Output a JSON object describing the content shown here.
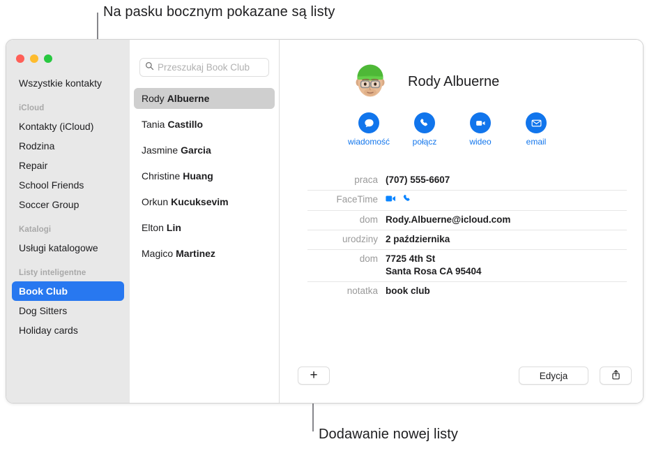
{
  "callouts": {
    "top": "Na pasku bocznym pokazane są listy",
    "bottom": "Dodawanie nowej listy"
  },
  "window": {
    "traffic_lights": {
      "close": "close-button",
      "minimize": "minimize-button",
      "zoom": "zoom-button"
    }
  },
  "sidebar": {
    "all_contacts": "Wszystkie kontakty",
    "sections": [
      {
        "header": "iCloud",
        "items": [
          {
            "label": "Kontakty (iCloud)",
            "selected": false
          },
          {
            "label": "Rodzina",
            "selected": false
          },
          {
            "label": "Repair",
            "selected": false
          },
          {
            "label": "School Friends",
            "selected": false
          },
          {
            "label": "Soccer Group",
            "selected": false
          }
        ]
      },
      {
        "header": "Katalogi",
        "items": [
          {
            "label": "Usługi katalogowe",
            "selected": false
          }
        ]
      },
      {
        "header": "Listy inteligentne",
        "items": [
          {
            "label": "Book Club",
            "selected": true
          },
          {
            "label": "Dog Sitters",
            "selected": false
          },
          {
            "label": "Holiday cards",
            "selected": false
          }
        ]
      }
    ],
    "selected_accent": "#2878f0"
  },
  "list": {
    "search": {
      "placeholder": "Przeszukaj Book Club",
      "value": "",
      "icon": "search-icon"
    },
    "contacts": [
      {
        "first": "Rody",
        "last": "Albuerne",
        "selected": true
      },
      {
        "first": "Tania",
        "last": "Castillo",
        "selected": false
      },
      {
        "first": "Jasmine",
        "last": "Garcia",
        "selected": false
      },
      {
        "first": "Christine",
        "last": "Huang",
        "selected": false
      },
      {
        "first": "Orkun",
        "last": "Kucuksevim",
        "selected": false
      },
      {
        "first": "Elton",
        "last": "Lin",
        "selected": false
      },
      {
        "first": "Magico",
        "last": "Martinez",
        "selected": false
      }
    ],
    "selected_background": "#cfcfcf"
  },
  "detail": {
    "name": "Rody Albuerne",
    "avatar": "memoji-avatar",
    "accent": "#1175ec",
    "actions": [
      {
        "label": "wiadomość",
        "icon": "message-icon"
      },
      {
        "label": "połącz",
        "icon": "phone-icon"
      },
      {
        "label": "wideo",
        "icon": "video-icon"
      },
      {
        "label": "email",
        "icon": "envelope-icon"
      }
    ],
    "fields": [
      {
        "label": "praca",
        "value": "(707) 555-6607",
        "type": "text"
      },
      {
        "label": "FaceTime",
        "value": "",
        "type": "icons",
        "icons": [
          "video-icon",
          "phone-icon"
        ]
      },
      {
        "label": "dom",
        "value": "Rody.Albuerne@icloud.com",
        "type": "text"
      },
      {
        "label": "urodziny",
        "value": "2 października",
        "type": "text"
      },
      {
        "label": "dom",
        "value": "7725 4th St\nSanta Rosa CA 95404",
        "type": "address",
        "line1": "7725 4th St",
        "line2": "Santa Rosa CA 95404"
      },
      {
        "label": "notatka",
        "value": "book club",
        "type": "text"
      }
    ]
  },
  "toolbar": {
    "add_label": "+",
    "edit_label": "Edycja",
    "share_icon": "share-icon"
  }
}
